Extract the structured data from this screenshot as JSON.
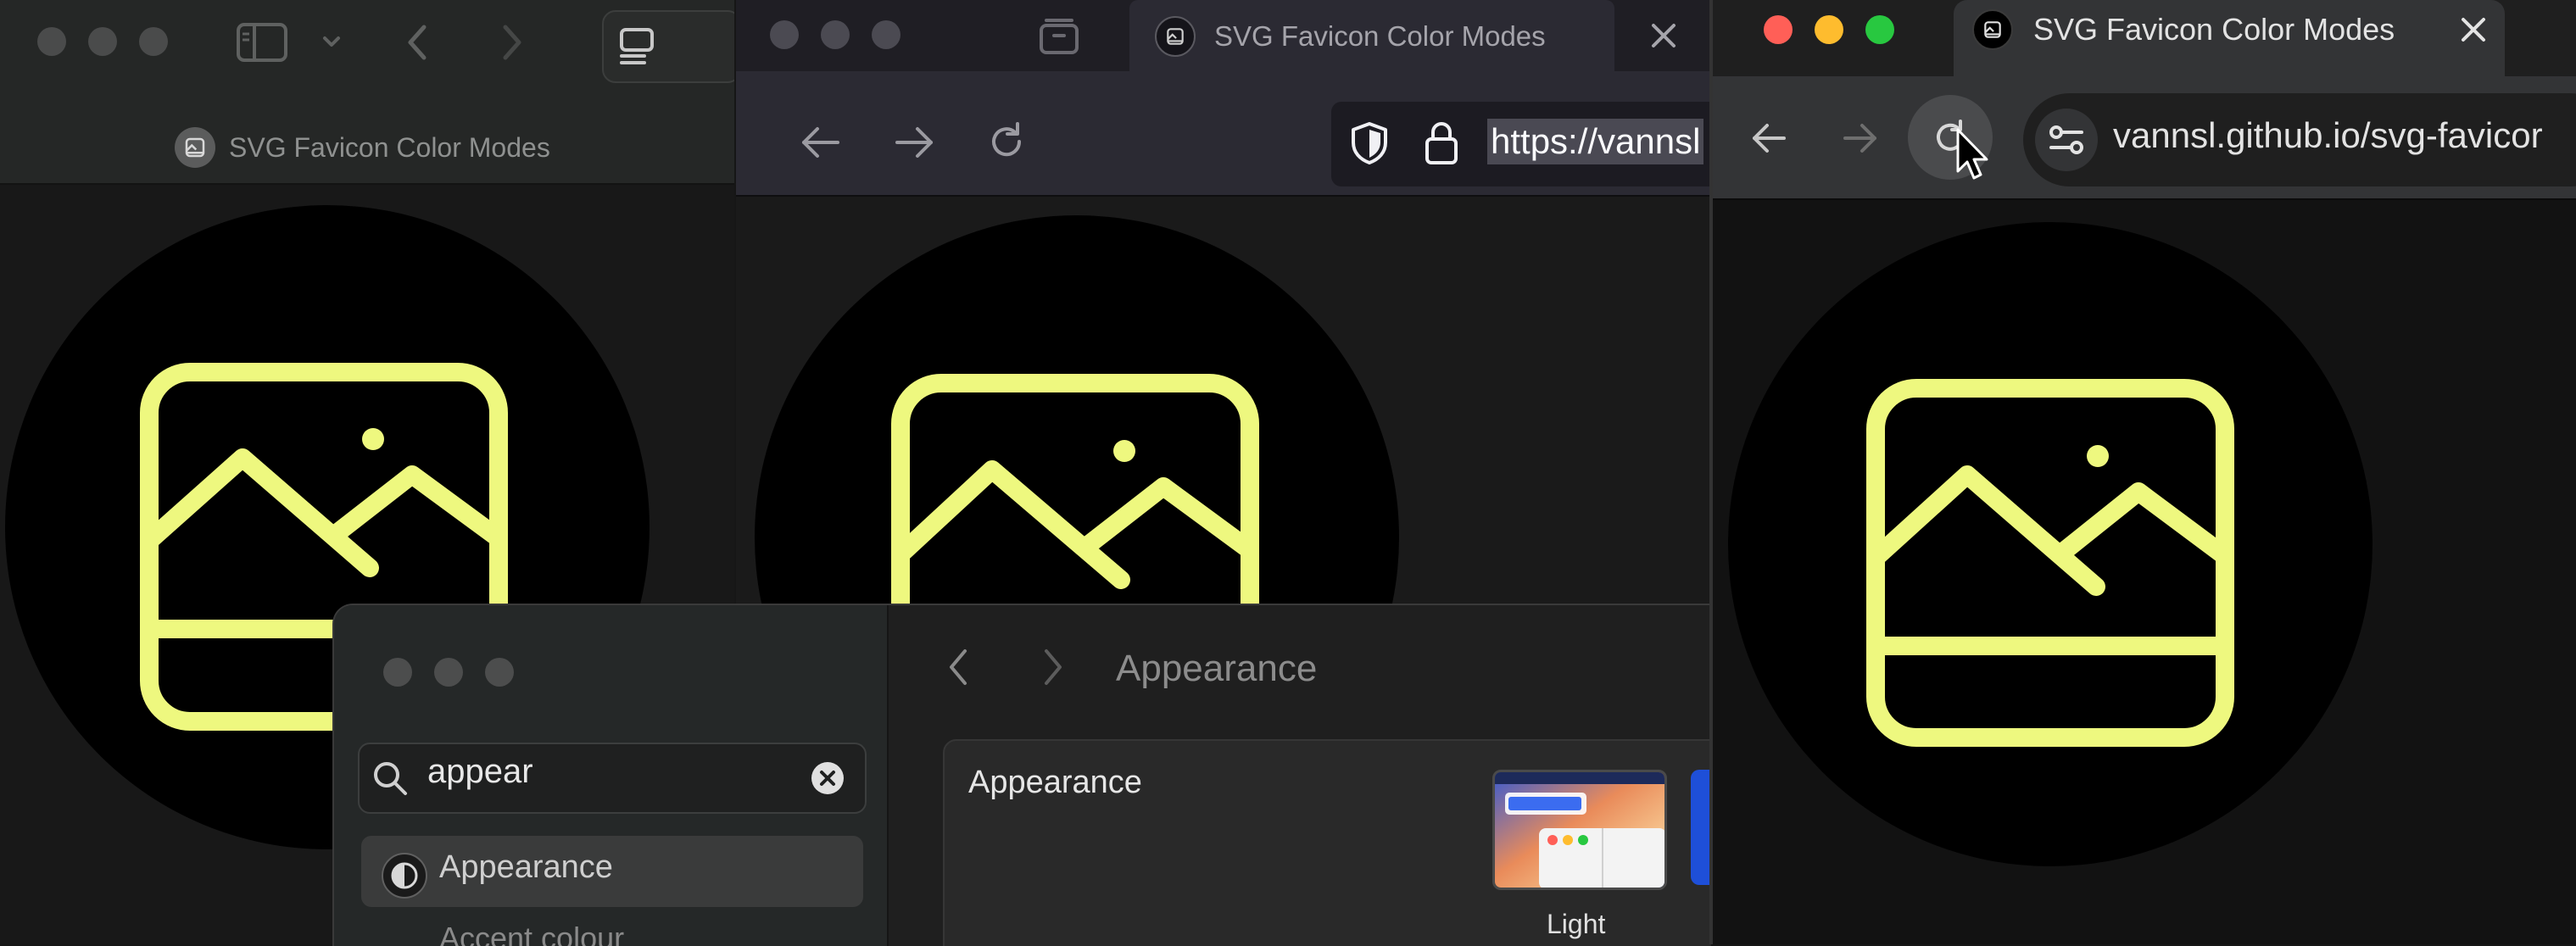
{
  "colors": {
    "icon_stroke": "#eef87f",
    "circle_bg": "#000000",
    "chrome_close": "#ff5f57",
    "chrome_minimize": "#febc2e",
    "chrome_zoom": "#28c840"
  },
  "safari": {
    "tab_title": "SVG Favicon Color Modes",
    "icons": [
      "traffic-lights",
      "sidebar-icon",
      "chevron-down-icon",
      "back-icon",
      "forward-icon",
      "tab-overview-icon",
      "image-icon"
    ]
  },
  "firefox": {
    "tab_title": "SVG Favicon Color Modes",
    "url": "https://vannsl",
    "icons": [
      "tab-list-icon",
      "close-icon",
      "back-icon",
      "forward-icon",
      "reload-icon",
      "shield-icon",
      "lock-icon",
      "image-icon"
    ]
  },
  "chrome": {
    "tab_title": "SVG Favicon Color Modes",
    "url": "vannsl.github.io/svg-favicor",
    "icons": [
      "close-icon",
      "back-icon",
      "forward-icon",
      "reload-icon",
      "site-settings-icon",
      "cursor-icon",
      "image-icon"
    ]
  },
  "settings": {
    "search_value": "appear",
    "selected_item": "Appearance",
    "next_item": "Accent colour",
    "page_title": "Appearance",
    "panel_title": "Appearance",
    "theme_option": "Light",
    "icons": [
      "search-icon",
      "clear-icon",
      "appearance-icon",
      "back-icon",
      "forward-icon"
    ]
  }
}
